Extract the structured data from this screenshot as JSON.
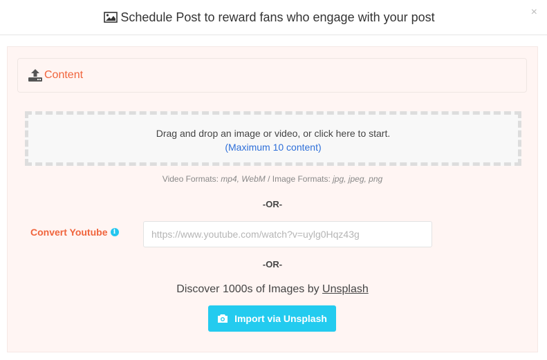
{
  "header": {
    "title": "Schedule Post to reward fans who engage with your post",
    "title_icon": "image-icon",
    "close_label": "×"
  },
  "content_section": {
    "icon": "upload-icon",
    "label": "Content"
  },
  "dropzone": {
    "instruction": "Drag and drop an image or video, or click here to start.",
    "limit": "(Maximum 10 content)"
  },
  "formats": {
    "video_label": "Video Formats: ",
    "video_values": "mp4, WebM",
    "separator": " / ",
    "image_label": "Image Formats: ",
    "image_values": "jpg, jpeg, png"
  },
  "divider_text": "-OR-",
  "youtube": {
    "label": "Convert Youtube",
    "info_icon": "info-icon",
    "value": "",
    "placeholder": "https://www.youtube.com/watch?v=uylg0Hqz43g"
  },
  "unsplash": {
    "discover_prefix": "Discover 1000s of Images by ",
    "discover_link": "Unsplash",
    "button_label": "Import via Unsplash",
    "button_icon": "camera-icon"
  },
  "colors": {
    "accent": "#f0643c",
    "link": "#2e6fd9",
    "button": "#23cbef",
    "panel_bg": "#fff5f3"
  }
}
